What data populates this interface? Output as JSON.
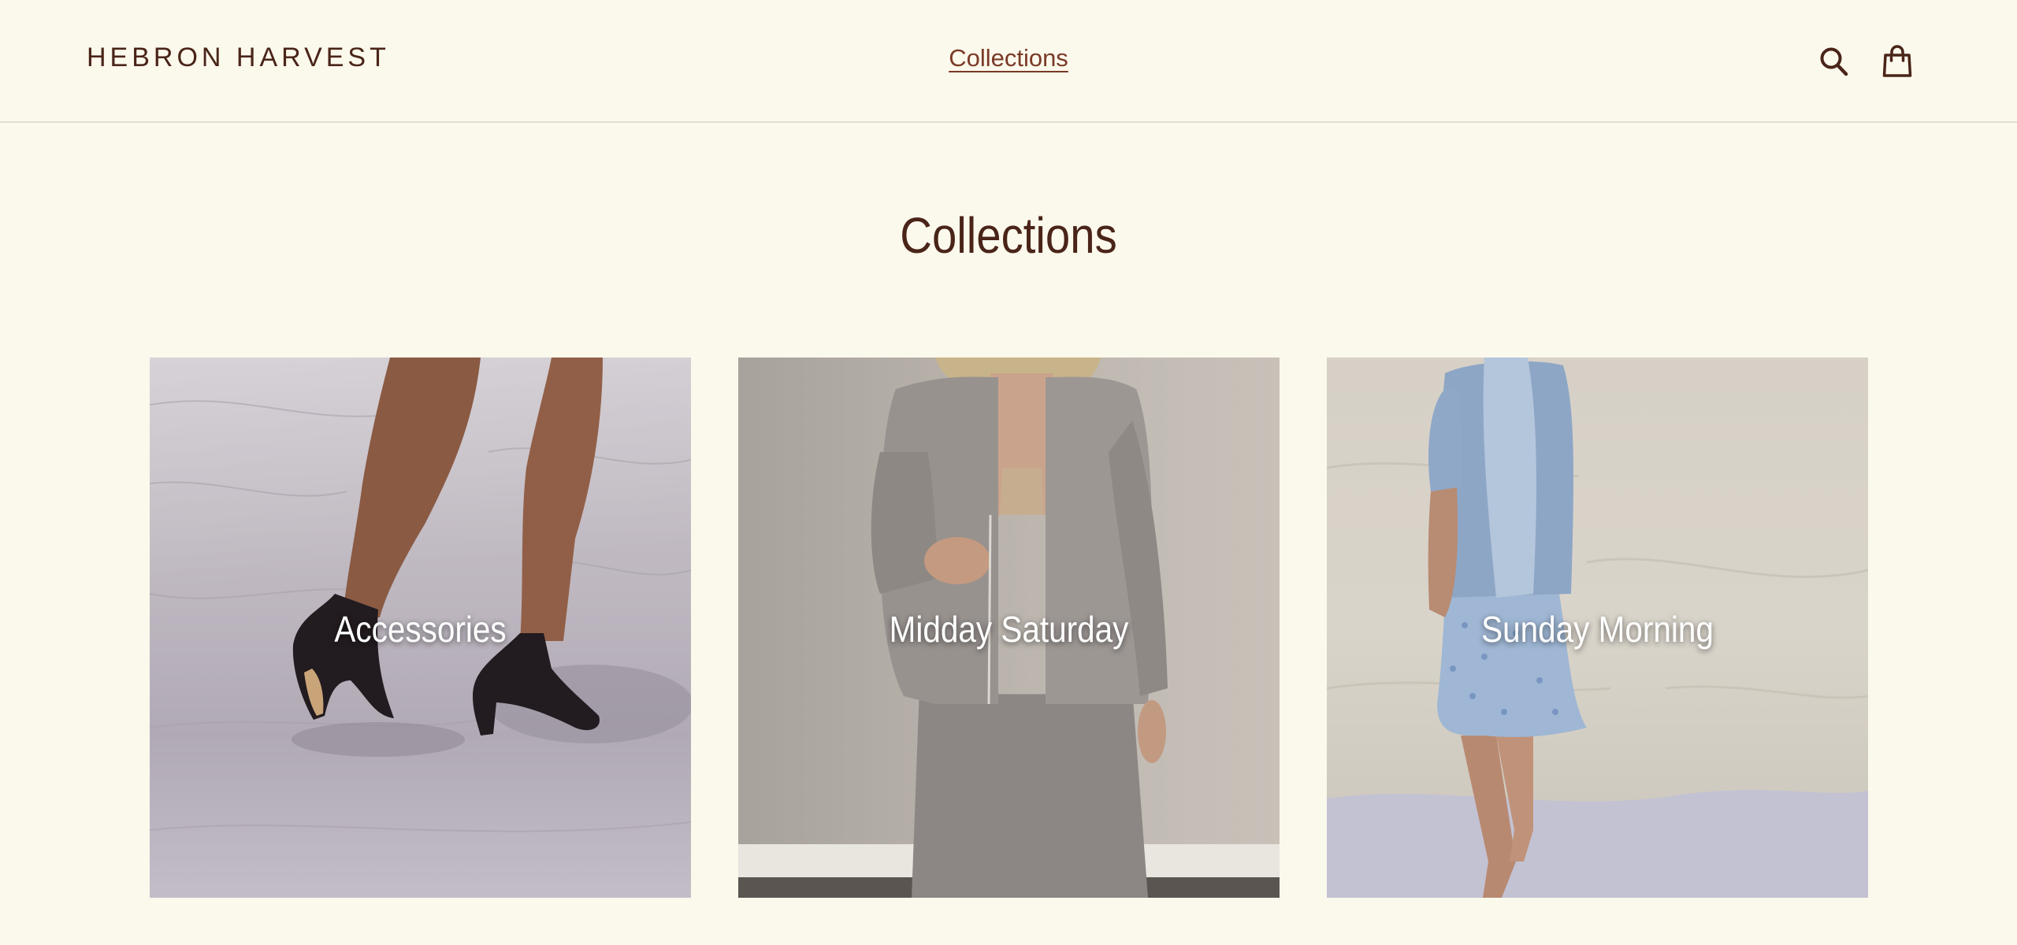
{
  "header": {
    "logo": "HEBRON HARVEST",
    "nav": [
      {
        "label": "Collections"
      }
    ],
    "icons": [
      "search-icon",
      "cart-icon"
    ]
  },
  "main": {
    "title": "Collections",
    "collections": [
      {
        "label": "Accessories"
      },
      {
        "label": "Midday Saturday"
      },
      {
        "label": "Sunday Morning"
      }
    ]
  },
  "colors": {
    "background": "#fbf8ec",
    "text": "#4a2418",
    "link": "#7a3a26",
    "divider": "#e2ddd0"
  }
}
